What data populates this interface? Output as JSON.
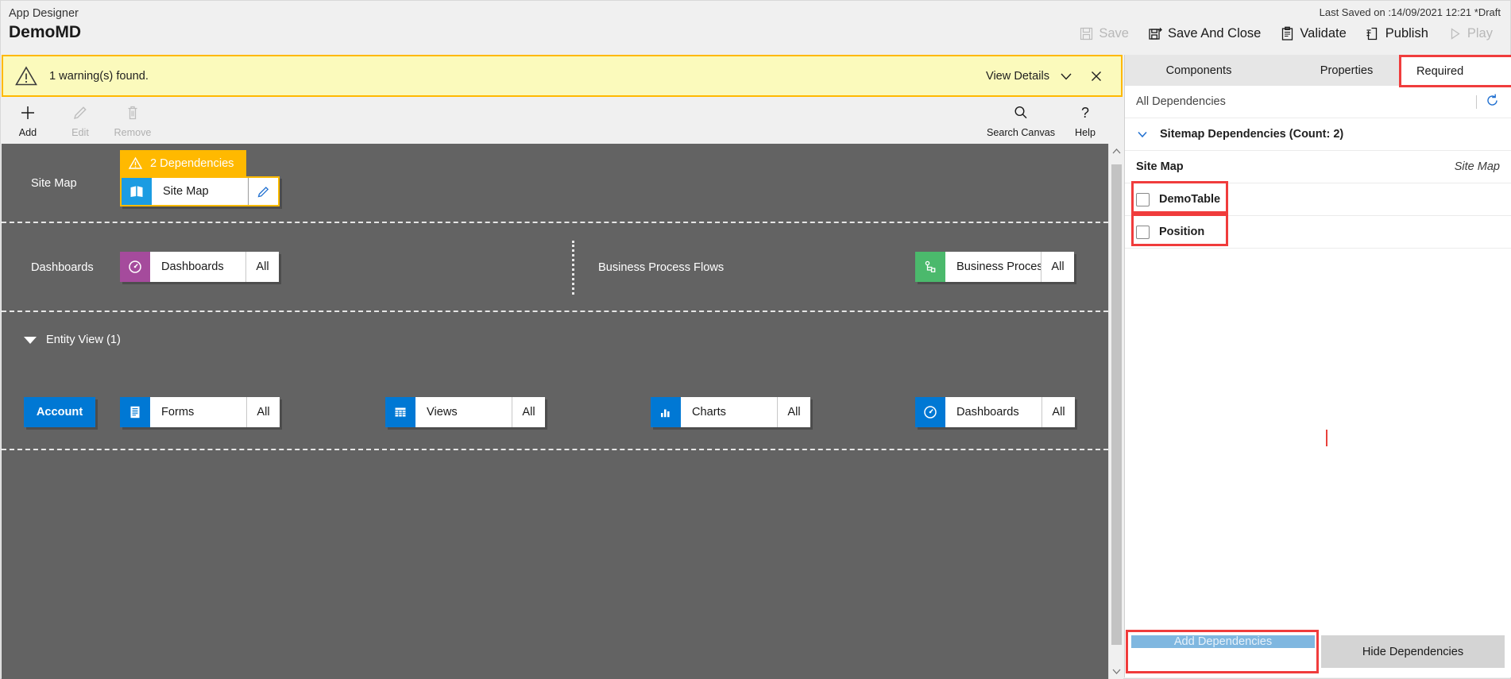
{
  "header": {
    "app_label": "App Designer",
    "app_title": "DemoMD",
    "last_saved": "Last Saved on :14/09/2021 12:21 *Draft",
    "commands": [
      {
        "label": "Save",
        "icon": "save-icon",
        "disabled": true
      },
      {
        "label": "Save And Close",
        "icon": "save-and-close-icon",
        "disabled": false
      },
      {
        "label": "Validate",
        "icon": "validate-clipboard-icon",
        "disabled": false
      },
      {
        "label": "Publish",
        "icon": "publish-icon",
        "disabled": false
      },
      {
        "label": "Play",
        "icon": "play-triangle-icon",
        "disabled": true
      }
    ]
  },
  "warning": {
    "text": "1 warning(s) found.",
    "view_details": "View Details",
    "chevron_icon": "chevron-down-icon",
    "close_icon": "close-icon",
    "bg": "#fbfabc",
    "border": "#ffb900"
  },
  "canvas_toolbar": {
    "items": [
      {
        "label": "Add",
        "icon": "plus-icon",
        "disabled": false
      },
      {
        "label": "Edit",
        "icon": "pencil-icon",
        "disabled": true
      },
      {
        "label": "Remove",
        "icon": "trash-icon",
        "disabled": true
      }
    ],
    "right_items": [
      {
        "label": "Search Canvas",
        "icon": "search-icon",
        "disabled": false
      },
      {
        "label": "Help",
        "icon": "question-mark-icon",
        "disabled": false
      }
    ]
  },
  "canvas": {
    "sitemap_row": {
      "label": "Site Map",
      "dependency_badge": "2 Dependencies",
      "dependency_icon": "warning-triangle-icon",
      "tile_name": "Site Map",
      "tile_icon": "sitemap-book-icon",
      "edit_icon": "pencil-icon"
    },
    "dashboards_row": {
      "label": "Dashboards",
      "tile_name": "Dashboards",
      "tile_icon": "dashboard-gauge-icon",
      "tile_meta": "All"
    },
    "bpf_row": {
      "label": "Business Process Flows",
      "tile_name": "Business Proces...",
      "tile_icon": "process-flow-icon",
      "tile_meta": "All"
    },
    "entity_view": {
      "group_label": "Entity View (1)",
      "collapse_icon": "triangle-down-icon",
      "entity_button": "Account",
      "tiles": [
        {
          "name": "Forms",
          "icon": "forms-icon",
          "meta": "All"
        },
        {
          "name": "Views",
          "icon": "views-grid-icon",
          "meta": "All"
        },
        {
          "name": "Charts",
          "icon": "charts-bar-icon",
          "meta": "All"
        },
        {
          "name": "Dashboards",
          "icon": "dashboard-gauge-icon",
          "meta": "All"
        }
      ]
    }
  },
  "right_panel": {
    "tabs": [
      {
        "label": "Components",
        "active": false,
        "highlighted": false
      },
      {
        "label": "Properties",
        "active": false,
        "highlighted": false
      },
      {
        "label": "Required",
        "active": true,
        "highlighted": true
      }
    ],
    "all_dependencies": "All Dependencies",
    "refresh_icon": "refresh-circular-arrow-icon",
    "section": {
      "label": "Sitemap Dependencies (Count: 2)",
      "chevron_icon": "chevron-down-icon"
    },
    "sitemap_row": {
      "name": "Site Map",
      "type": "Site Map"
    },
    "dependency_rows": [
      {
        "name": "DemoTable",
        "checked": false,
        "highlighted": true
      },
      {
        "name": "Position",
        "checked": false,
        "highlighted": true
      }
    ],
    "footer": {
      "add_label": "Add Dependencies",
      "add_disabled": true,
      "add_highlighted": true,
      "hide_label": "Hide Dependencies"
    }
  },
  "colors": {
    "accent_blue": "#0078d4",
    "warning_yellow": "#ffb900",
    "canvas_gray": "#636363",
    "dashboard_purple": "#a54b9c",
    "bpf_green": "#4bb96c",
    "highlight_red": "#f03c3c"
  }
}
